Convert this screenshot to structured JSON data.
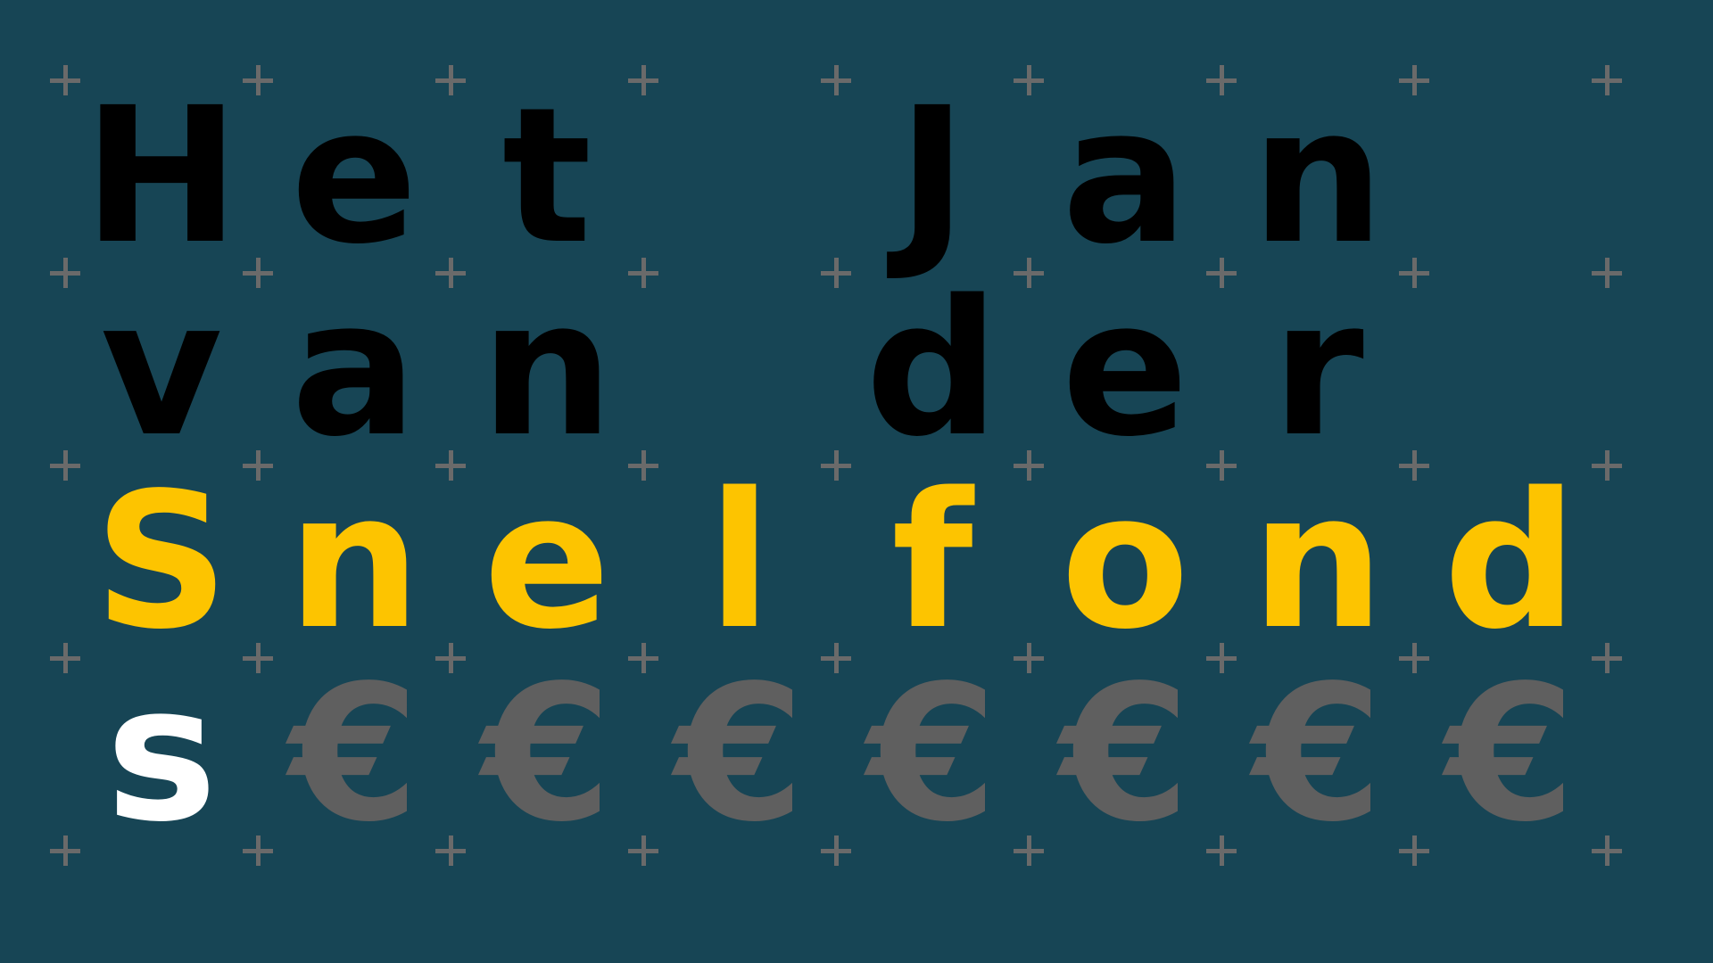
{
  "colors": {
    "background": "#174555",
    "plus": "#6a6a6a",
    "black": "#000000",
    "yellow": "#fdc400",
    "white": "#ffffff",
    "grey": "#5f5f5f"
  },
  "rows": [
    {
      "cells": [
        {
          "ch": "H",
          "color": "black"
        },
        {
          "ch": "e",
          "color": "black"
        },
        {
          "ch": "t",
          "color": "black"
        },
        {
          "ch": "",
          "color": "black"
        },
        {
          "ch": "J",
          "color": "black"
        },
        {
          "ch": "a",
          "color": "black"
        },
        {
          "ch": "n",
          "color": "black"
        },
        {
          "ch": "",
          "color": "black"
        }
      ]
    },
    {
      "cells": [
        {
          "ch": "v",
          "color": "black"
        },
        {
          "ch": "a",
          "color": "black"
        },
        {
          "ch": "n",
          "color": "black"
        },
        {
          "ch": "",
          "color": "black"
        },
        {
          "ch": "d",
          "color": "black"
        },
        {
          "ch": "e",
          "color": "black"
        },
        {
          "ch": "r",
          "color": "black"
        },
        {
          "ch": "",
          "color": "black"
        }
      ]
    },
    {
      "cells": [
        {
          "ch": "S",
          "color": "yellow"
        },
        {
          "ch": "n",
          "color": "yellow"
        },
        {
          "ch": "e",
          "color": "yellow"
        },
        {
          "ch": "l",
          "color": "yellow"
        },
        {
          "ch": "f",
          "color": "yellow"
        },
        {
          "ch": "o",
          "color": "yellow"
        },
        {
          "ch": "n",
          "color": "yellow"
        },
        {
          "ch": "d",
          "color": "yellow"
        }
      ]
    },
    {
      "cells": [
        {
          "ch": "s",
          "color": "white"
        },
        {
          "ch": "€",
          "color": "grey"
        },
        {
          "ch": "€",
          "color": "grey"
        },
        {
          "ch": "€",
          "color": "grey"
        },
        {
          "ch": "€",
          "color": "grey"
        },
        {
          "ch": "€",
          "color": "grey"
        },
        {
          "ch": "€",
          "color": "grey"
        },
        {
          "ch": "€",
          "color": "grey"
        }
      ]
    }
  ]
}
